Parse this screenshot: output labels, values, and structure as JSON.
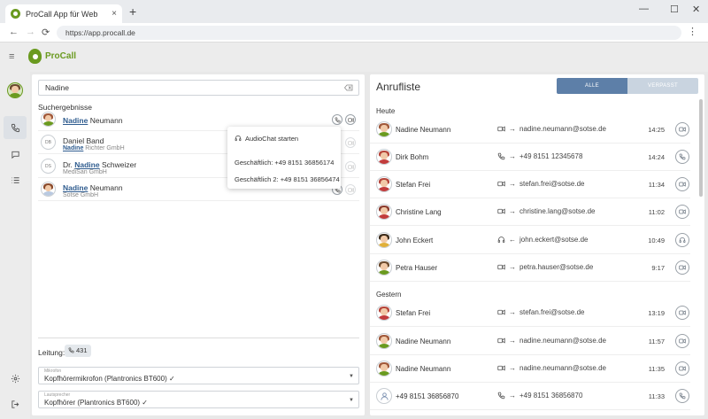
{
  "browser": {
    "tab_title": "ProCall App für Web",
    "tab_close": "×",
    "new_tab": "+",
    "url": "https://app.procall.de",
    "win_min": "—",
    "win_max": "☐",
    "win_close": "✕",
    "back": "←",
    "forward": "→",
    "reload": "⟳",
    "menu": "⋮"
  },
  "app": {
    "brand": "ProCall",
    "accent": "#6a9a1f",
    "menu_icon": "≡"
  },
  "search": {
    "value": "Nadine",
    "section_label": "Suchergebnisse",
    "results": [
      {
        "highlight": "Nadine",
        "rest": " Neumann",
        "sub_highlight": "",
        "sub_rest": ""
      },
      {
        "pre": "Daniel Band",
        "sub_highlight": "Nadine",
        "sub_rest": " Richter GmbH",
        "initials": "DB"
      },
      {
        "pre": "Dr. ",
        "highlight": "Nadine",
        "rest": " Schweizer",
        "sub_rest": "MediSan GmbH",
        "initials": "DS"
      },
      {
        "highlight": "Nadine",
        "rest": " Neumann",
        "sub_rest": "Sotse GmbH"
      }
    ]
  },
  "popup": {
    "audio_chat": "AudioChat starten",
    "business": "Geschäftlich: +49 8151 36856174",
    "business2": "Geschäftlich 2: +49 8151 36856474"
  },
  "line": {
    "label": "Leitung:",
    "number": "431",
    "mic_caption": "Mikrofon",
    "mic_value": "Kopfhörermikrofon (Plantronics BT600) ✓",
    "speaker_caption": "Lautsprecher",
    "speaker_value": "Kopfhörer (Plantronics BT600) ✓",
    "dropdown_arrow": "▼"
  },
  "calllist": {
    "title": "Anrufliste",
    "filter_all": "ALLE",
    "filter_missed": "VERPASST",
    "today": "Heute",
    "yesterday": "Gestern",
    "rows": [
      {
        "name": "Nadine Neumann",
        "target": "nadine.neumann@sotse.de",
        "time": "14:25",
        "dir": "→"
      },
      {
        "name": "Dirk Bohm",
        "target": "+49 8151 12345678",
        "time": "14:24",
        "dir": "→"
      },
      {
        "name": "Stefan Frei",
        "target": "stefan.frei@sotse.de",
        "time": "11:34",
        "dir": "→"
      },
      {
        "name": "Christine Lang",
        "target": "christine.lang@sotse.de",
        "time": "11:02",
        "dir": "→"
      },
      {
        "name": "John Eckert",
        "target": "john.eckert@sotse.de",
        "time": "10:49",
        "dir": "←"
      },
      {
        "name": "Petra Hauser",
        "target": "petra.hauser@sotse.de",
        "time": "9:17",
        "dir": "→"
      },
      {
        "name": "Stefan Frei",
        "target": "stefan.frei@sotse.de",
        "time": "13:19",
        "dir": "→"
      },
      {
        "name": "Nadine Neumann",
        "target": "nadine.neumann@sotse.de",
        "time": "11:57",
        "dir": "→"
      },
      {
        "name": "Nadine Neumann",
        "target": "nadine.neumann@sotse.de",
        "time": "11:35",
        "dir": "→"
      },
      {
        "name": "+49 8151 36856870",
        "target": "+49 8151 36856870",
        "time": "11:33",
        "dir": "→"
      }
    ]
  }
}
